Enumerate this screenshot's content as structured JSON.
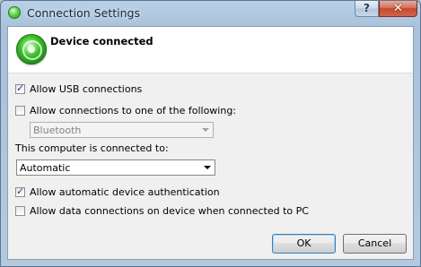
{
  "window": {
    "title": "Connection Settings",
    "help_label": "?",
    "close_label": "✕"
  },
  "header": {
    "icon": "connected-status-icon",
    "title": "Device connected"
  },
  "options": {
    "allow_usb": {
      "label": "Allow USB connections",
      "checked": true,
      "check_mark": "✓"
    },
    "allow_one_of": {
      "label": "Allow connections to one of the following:",
      "checked": false
    },
    "bluetooth_select": {
      "value": "Bluetooth",
      "disabled": true
    },
    "connected_to_label": "This computer is connected to:",
    "connected_to_select": {
      "value": "Automatic"
    },
    "allow_auth": {
      "label": "Allow automatic device authentication",
      "checked": true,
      "check_mark": "✓"
    },
    "allow_data": {
      "label": "Allow data connections on device when connected to PC",
      "checked": false
    }
  },
  "buttons": {
    "ok": "OK",
    "cancel": "Cancel"
  },
  "colors": {
    "status_green": "#3cbd2c",
    "close_red": "#c44a30"
  }
}
